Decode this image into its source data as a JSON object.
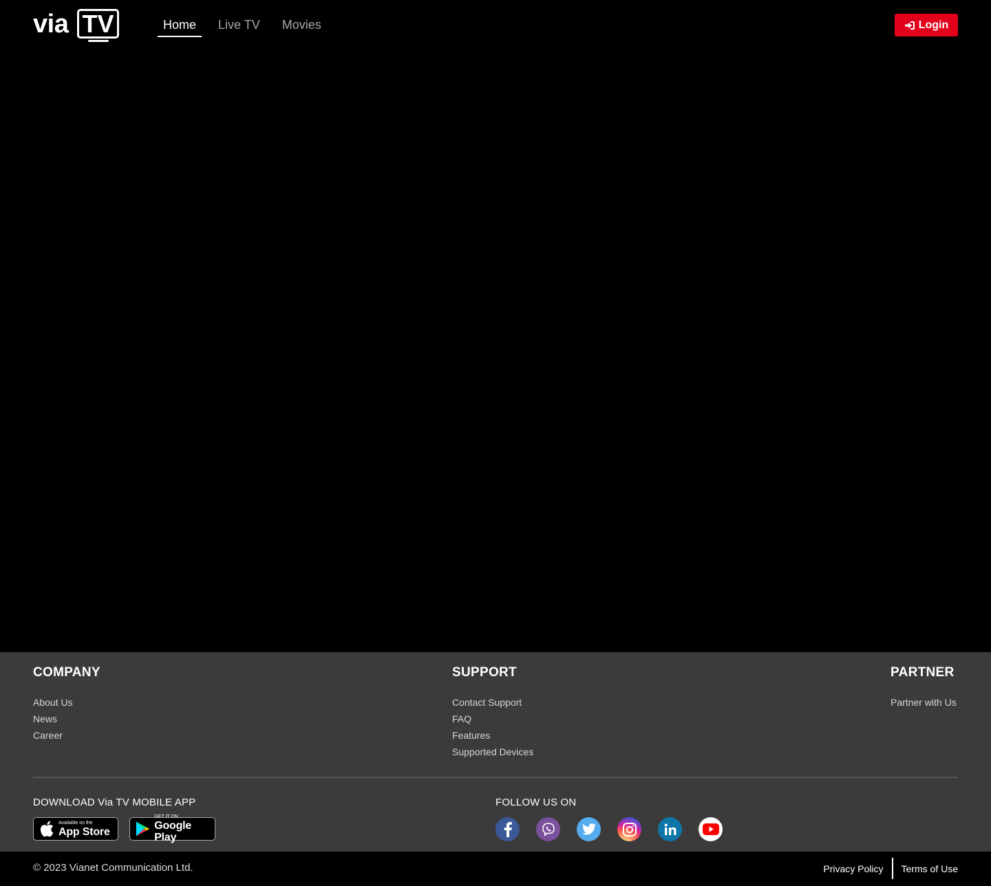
{
  "header": {
    "logo_via": "via",
    "logo_tv": "TV",
    "nav": [
      {
        "label": "Home",
        "active": true
      },
      {
        "label": "Live TV",
        "active": false
      },
      {
        "label": "Movies",
        "active": false
      }
    ],
    "login_label": "Login"
  },
  "footer": {
    "company": {
      "title": "COMPANY",
      "links": [
        "About Us",
        "News",
        "Career"
      ]
    },
    "support": {
      "title": "SUPPORT",
      "links": [
        "Contact Support",
        "FAQ",
        "Features",
        "Supported Devices"
      ]
    },
    "partner": {
      "title": "PARTNER",
      "links": [
        "Partner with Us"
      ]
    },
    "download": {
      "title": "DOWNLOAD Via TV MOBILE APP",
      "apple_small": "Available on the",
      "apple_big": "App Store",
      "google_small": "GET IT ON",
      "google_big": "Google Play"
    },
    "follow": {
      "title": "FOLLOW US ON",
      "icons": [
        "facebook-icon",
        "viber-icon",
        "twitter-icon",
        "instagram-icon",
        "linkedin-icon",
        "youtube-icon"
      ]
    },
    "copyright": "© 2023 Vianet Communication Ltd.",
    "privacy": "Privacy Policy",
    "terms": "Terms of Use"
  },
  "colors": {
    "accent": "#e2001a",
    "footer_bg": "#3b3b3b",
    "page_bg": "#000000"
  }
}
